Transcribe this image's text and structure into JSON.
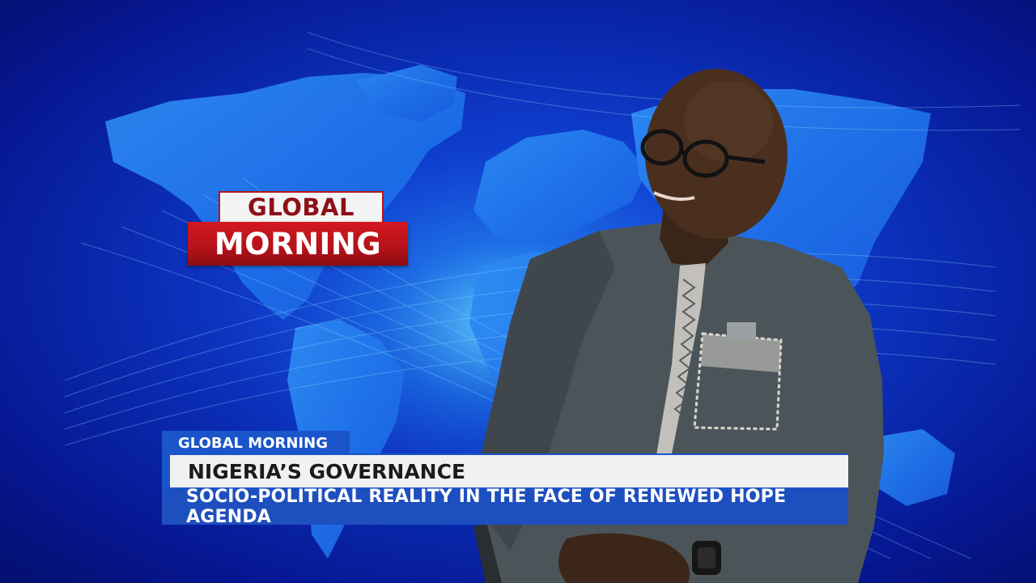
{
  "logo": {
    "line1": "GLOBAL",
    "line2": "MORNING"
  },
  "lower_third": {
    "program": "GLOBAL MORNING",
    "headline": "NIGERIA’S GOVERNANCE",
    "subheadline": "SOCIO-POLITICAL REALITY IN THE FACE OF RENEWED HOPE AGENDA"
  },
  "colors": {
    "background": "#0a2ab0",
    "logo_red": "#c0141c",
    "banner_blue": "#1a55c9",
    "banner_white": "#f1f1f1"
  }
}
